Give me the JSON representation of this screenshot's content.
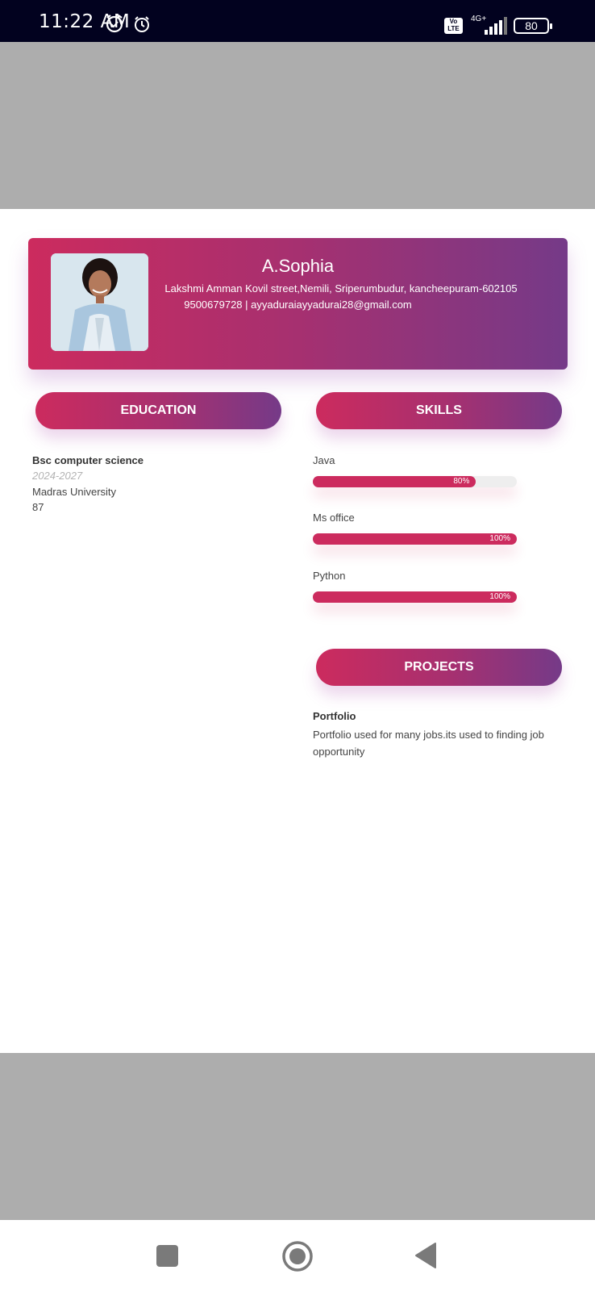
{
  "status_bar": {
    "time": "11:22 AM",
    "network_badge": "Vo LTE",
    "network_type": "4G+",
    "battery": "80"
  },
  "header": {
    "name": "A.Sophia",
    "address": "Lakshmi Amman Kovil street,Nemili, Sriperumbudur, kancheepuram-602105",
    "contact": "9500679728 | ayyaduraiayyadurai28@gmail.com"
  },
  "education": {
    "title": "EDUCATION",
    "items": [
      {
        "degree": "Bsc computer science",
        "years": "2024-2027",
        "institution": "Madras University",
        "score": "87"
      }
    ]
  },
  "skills": {
    "title": "SKILLS",
    "items": [
      {
        "name": "Java",
        "percent_label": "80%",
        "level": 0.8
      },
      {
        "name": "Ms office",
        "percent_label": "100%",
        "level": 1.0
      },
      {
        "name": "Python",
        "percent_label": "100%",
        "level": 1.0
      }
    ]
  },
  "projects": {
    "title": "PROJECTS",
    "items": [
      {
        "name": "Portfolio",
        "description": "Portfolio used for many jobs.its used to finding job opportunity"
      }
    ]
  },
  "colors": {
    "gradient_start": "#cc2b5e",
    "gradient_end": "#753a88",
    "status_bar_bg": "#02021f",
    "gray_band": "#adadad"
  },
  "nav": {
    "icons": [
      "recents-square-icon",
      "home-circle-icon",
      "back-triangle-icon"
    ]
  }
}
